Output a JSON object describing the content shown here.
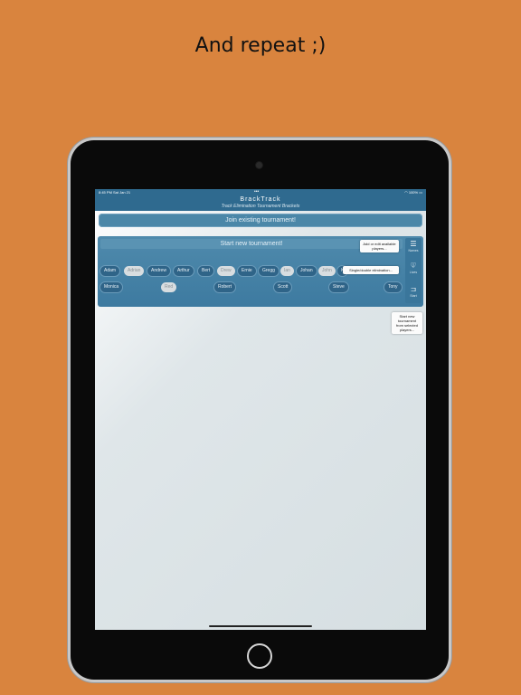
{
  "caption": "And repeat ;)",
  "status_bar": {
    "time": "8:45 PM   Sat Jan 21",
    "battery": "100%"
  },
  "nav": {
    "title": "BrackTrack",
    "subtitle": "Track Elimination Tournament Brackets"
  },
  "join_button": "Join existing tournament!",
  "start_header": "Start new tournament!",
  "side_buttons": [
    {
      "icon": "list-icon",
      "label": "Names"
    },
    {
      "icon": "heart-icon",
      "value": "2",
      "label": "Lives"
    },
    {
      "icon": "bracket-icon",
      "label": "Start"
    }
  ],
  "tooltips": {
    "names": "Add or edit available players...",
    "lives": "Single/double elimination...",
    "start": "Start new tournament from selected players..."
  },
  "players": [
    {
      "name": "Adam",
      "selected": true
    },
    {
      "name": "Adrian",
      "selected": false
    },
    {
      "name": "Andrew",
      "selected": true
    },
    {
      "name": "Arthur",
      "selected": true
    },
    {
      "name": "Bert",
      "selected": true
    },
    {
      "name": "Drew",
      "selected": false
    },
    {
      "name": "Ernie",
      "selected": true
    },
    {
      "name": "Gregg",
      "selected": true
    },
    {
      "name": "Ian",
      "selected": false
    },
    {
      "name": "Johan",
      "selected": true
    },
    {
      "name": "John",
      "selected": false
    },
    {
      "name": "K",
      "selected": true
    },
    {
      "name": "Monica",
      "selected": true
    },
    {
      "name": "Red",
      "selected": false
    },
    {
      "name": "Robert",
      "selected": true
    },
    {
      "name": "Scott",
      "selected": true
    },
    {
      "name": "Steve",
      "selected": true
    },
    {
      "name": "Tony",
      "selected": true
    }
  ],
  "colors": {
    "background": "#d9843e",
    "nav": "#2f6a8f",
    "panel": "#3d7aa0"
  }
}
